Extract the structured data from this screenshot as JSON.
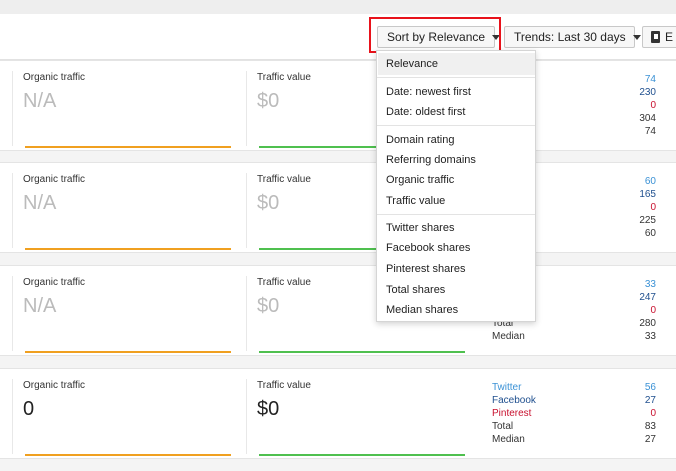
{
  "toolbar": {
    "sort_label": "Sort by Relevance",
    "trends_label": "Trends: Last 30 days",
    "export_label": "E"
  },
  "sort_menu": {
    "items": [
      "Relevance",
      "Date: newest first",
      "Date: oldest first",
      "Domain rating",
      "Referring domains",
      "Organic traffic",
      "Traffic value",
      "Twitter shares",
      "Facebook shares",
      "Pinterest shares",
      "Total shares",
      "Median shares"
    ]
  },
  "labels": {
    "organic_traffic": "Organic traffic",
    "traffic_value": "Traffic value",
    "twitter": "Twitter",
    "facebook": "Facebook",
    "pinterest": "Pinterest",
    "total": "Total",
    "median": "Median"
  },
  "results": [
    {
      "organic_traffic": "N/A",
      "traffic_value": "$0",
      "shares": {
        "twitter": "74",
        "facebook": "230",
        "pinterest": "0",
        "total": "304",
        "median": "74"
      }
    },
    {
      "organic_traffic": "N/A",
      "traffic_value": "$0",
      "shares": {
        "twitter": "60",
        "facebook": "165",
        "pinterest": "0",
        "total": "225",
        "median": "60"
      }
    },
    {
      "organic_traffic": "N/A",
      "traffic_value": "$0",
      "shares": {
        "twitter": "33",
        "facebook": "247",
        "pinterest": "0",
        "total": "280",
        "median": "33"
      }
    },
    {
      "organic_traffic": "0",
      "traffic_value": "$0",
      "shares": {
        "twitter": "56",
        "facebook": "27",
        "pinterest": "0",
        "total": "83",
        "median": "27"
      }
    }
  ],
  "colors": {
    "twitter": "#3a91d5",
    "facebook": "#20508f",
    "pinterest": "#c8102e",
    "highlight": "#e8121b",
    "trend_organic": "#f0a020",
    "trend_value": "#4fc04f"
  }
}
